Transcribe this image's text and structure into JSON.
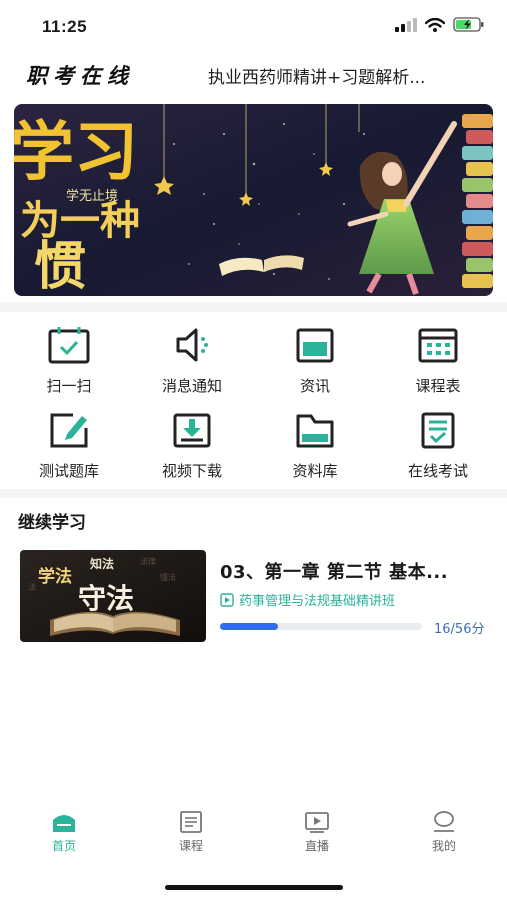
{
  "status": {
    "time": "11:25"
  },
  "header": {
    "brand": "职考在线",
    "course_title": "执业西药师精讲+习题解析..."
  },
  "banner": {
    "text_large_1": "学习",
    "text_large_2": "为一种",
    "text_large_3": "惯",
    "text_small": "学无止境"
  },
  "grid": {
    "items": [
      {
        "label": "扫一扫",
        "icon": "scan-icon"
      },
      {
        "label": "消息通知",
        "icon": "speaker-icon"
      },
      {
        "label": "资讯",
        "icon": "news-icon"
      },
      {
        "label": "课程表",
        "icon": "calendar-icon"
      },
      {
        "label": "测试题库",
        "icon": "edit-icon"
      },
      {
        "label": "视频下载",
        "icon": "download-icon"
      },
      {
        "label": "资料库",
        "icon": "folder-icon"
      },
      {
        "label": "在线考试",
        "icon": "exam-icon"
      }
    ]
  },
  "continue": {
    "section_title": "继续学习",
    "thumb_text_1": "学法",
    "thumb_text_2": "守法",
    "thumb_text_3": "知法",
    "card_title": "03、第一章 第二节 基本...",
    "card_subtitle": "药事管理与法规基础精讲班",
    "progress_text": "16/56分",
    "progress_fraction": 0.2857
  },
  "tabs": [
    {
      "label": "首页",
      "active": true
    },
    {
      "label": "课程",
      "active": false
    },
    {
      "label": "直播",
      "active": false
    },
    {
      "label": "我的",
      "active": false
    }
  ],
  "colors": {
    "accent": "#2bb39a",
    "progress": "#2f6ee6"
  }
}
